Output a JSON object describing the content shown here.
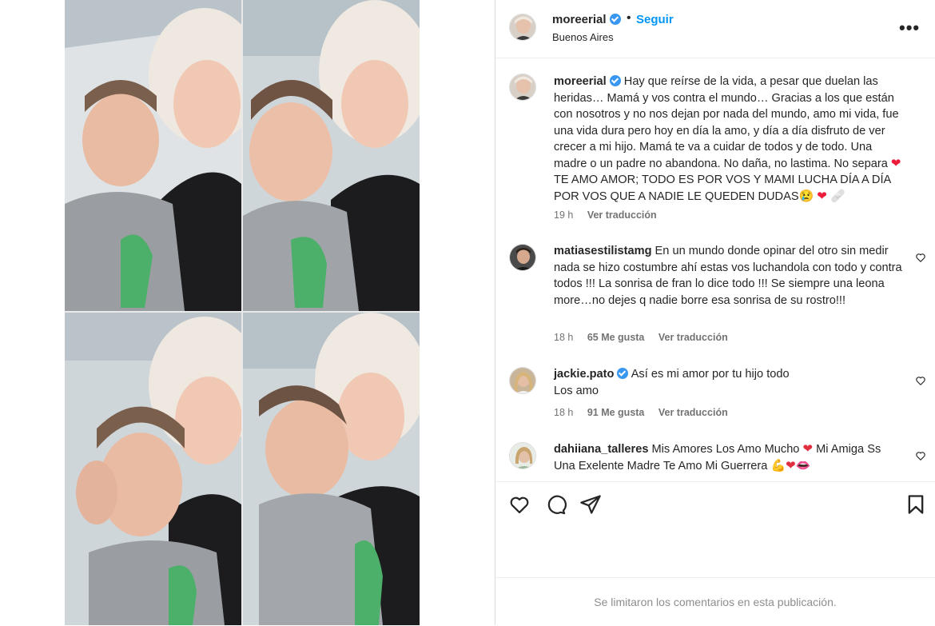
{
  "post": {
    "author": "moreerial",
    "follow_label": "Seguir",
    "separator": "•",
    "location": "Buenos Aires",
    "more_label": "•••"
  },
  "caption": {
    "username": "moreerial",
    "text_1": "Hay que reírse de la vida, a pesar que duelan las heridas… Mamá y vos contra el mundo… Gracias a los que están con nosotros y no nos dejan por nada del mundo, amo mi vida, fue una vida dura pero hoy en día la amo, y día a día disfruto de ver crecer a mi hijo. Mamá te va a cuidar de todos y de todo. Una madre o un padre no abandona. No daña, no lastima. No separa",
    "text_2": "TE AMO AMOR; TODO ES POR VOS Y MAMI LUCHA DÍA A DÍA POR VOS QUE A NADIE LE QUEDEN DUDAS",
    "time": "19 h",
    "translate": "Ver traducción"
  },
  "comments": [
    {
      "username": "matiasestilistamg",
      "text": "En un mundo donde opinar del otro sin medir nada se hizo costumbre ahí estas vos luchandola con todo y contra todos !!! La sonrisa de fran lo dice todo !!! Se siempre una leona more…no dejes q nadie borre esa sonrisa de su rostro!!!",
      "time": "18 h",
      "likes": "65 Me gusta",
      "translate": "Ver traducción"
    },
    {
      "username": "jackie.pato",
      "text_1": "Así es mi amor por tu hijo todo",
      "text_2": "Los amo",
      "time": "18 h",
      "likes": "91 Me gusta",
      "translate": "Ver traducción"
    },
    {
      "username": "dahiiana_talleres",
      "text_1": "Mis Amores Los Amo Mucho",
      "text_2": "Mi Amiga Ss Una Exelente Madre Te Amo Mi Guerrera"
    }
  ],
  "footer": {
    "limited_comments": "Se limitaron los comentarios en esta publicación."
  },
  "icons": {
    "verified": "verified-badge-icon",
    "like": "heart-icon",
    "comment": "comment-icon",
    "share": "share-icon",
    "save": "bookmark-icon",
    "more": "more-options-icon"
  },
  "colors": {
    "follow": "#0095f6",
    "verified": "#3897f0",
    "text": "#262626",
    "meta": "#737373",
    "heart_emoji": "#ed1c3a"
  }
}
